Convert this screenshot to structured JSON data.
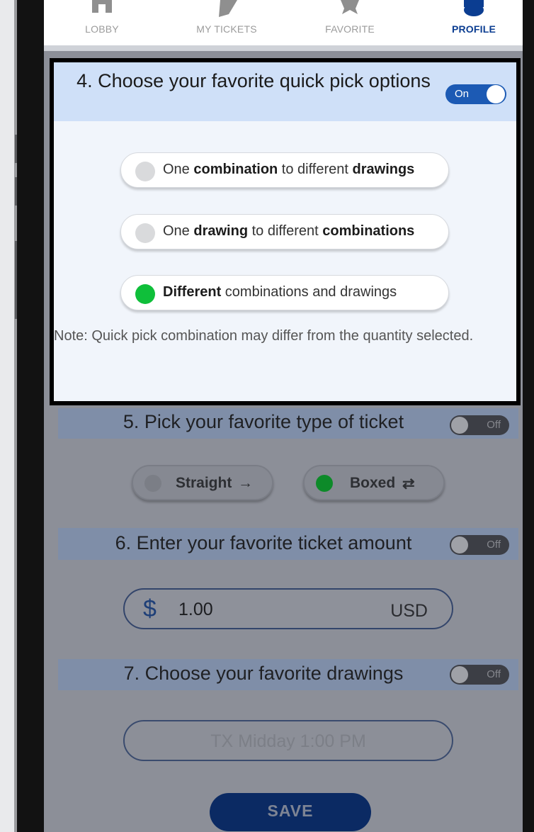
{
  "nav": {
    "items": [
      {
        "label": "LOBBY",
        "icon": "home-icon",
        "active": false
      },
      {
        "label": "MY TICKETS",
        "icon": "ticket-icon",
        "active": false
      },
      {
        "label": "FAVORITE",
        "icon": "star-icon",
        "active": false
      },
      {
        "label": "PROFILE",
        "icon": "user-icon",
        "active": true
      }
    ]
  },
  "section4": {
    "title": "4. Choose your favorite quick pick options",
    "toggle_label": "On",
    "options": [
      {
        "parts": [
          "One ",
          "combination",
          " to different ",
          "drawings"
        ],
        "selected": false
      },
      {
        "parts": [
          "One ",
          "drawing",
          " to different ",
          "combinations"
        ],
        "selected": false
      },
      {
        "parts": [
          "Different",
          " combinations and drawings",
          "",
          ""
        ],
        "selected": true
      }
    ],
    "note": "Note: Quick pick combination may differ from the quantity selected."
  },
  "section5": {
    "title": "5. Pick your favorite type of ticket",
    "toggle_label": "Off",
    "straight_label": "Straight",
    "straight_icon": "→",
    "boxed_label": "Boxed",
    "boxed_icon": "⇄"
  },
  "section6": {
    "title": "6. Enter your favorite ticket amount",
    "toggle_label": "Off",
    "currency_symbol": "$",
    "amount": "1.00",
    "currency": "USD"
  },
  "section7": {
    "title": "7. Choose your favorite drawings",
    "toggle_label": "Off",
    "drawing_placeholder": "TX Midday 1:00 PM"
  },
  "save_label": "SAVE",
  "colors": {
    "accent": "#1c5ab4",
    "active_nav": "#0b3d91",
    "selected_radio": "#0fbf3a"
  }
}
